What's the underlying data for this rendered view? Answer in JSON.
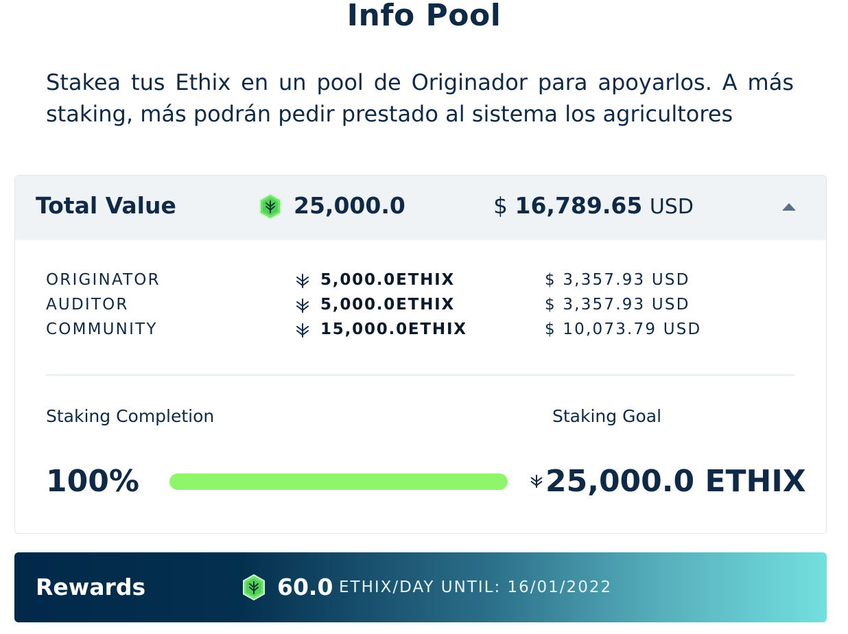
{
  "page": {
    "title": "Info Pool",
    "description": "Stakea tus Ethix en un pool de Originador para apoyarlos. A más staking, más podrán pedir prestado al sistema los agricultores"
  },
  "total_value": {
    "label": "Total Value",
    "ethix_amount": "25,000.0",
    "usd_symbol": "$",
    "usd_amount": "16,789.65",
    "usd_unit": "USD",
    "collapse_icon": "caret-up-icon"
  },
  "breakdown": [
    {
      "label": "ORIGINATOR",
      "amount": "5,000.0ETHIX",
      "usd": "$ 3,357.93 USD"
    },
    {
      "label": "AUDITOR",
      "amount": "5,000.0ETHIX",
      "usd": "$ 3,357.93 USD"
    },
    {
      "label": "COMMUNITY",
      "amount": "15,000.0ETHIX",
      "usd": "$ 10,073.79 USD"
    }
  ],
  "staking": {
    "completion_label": "Staking Completion",
    "goal_label": "Staking Goal",
    "completion_pct": "100%",
    "completion_fraction": 1.0,
    "goal_value": "25,000.0 ETHIX"
  },
  "rewards": {
    "label": "Rewards",
    "value": "60.0",
    "unit": "ETHIX/DAY UNTIL: 16/01/2022"
  },
  "colors": {
    "navy": "#0e2a47",
    "accent_green": "#8ff56b",
    "header_bg": "#f0f3f6",
    "rewards_gradient_start": "#02284a",
    "rewards_gradient_end": "#73dfdf"
  }
}
